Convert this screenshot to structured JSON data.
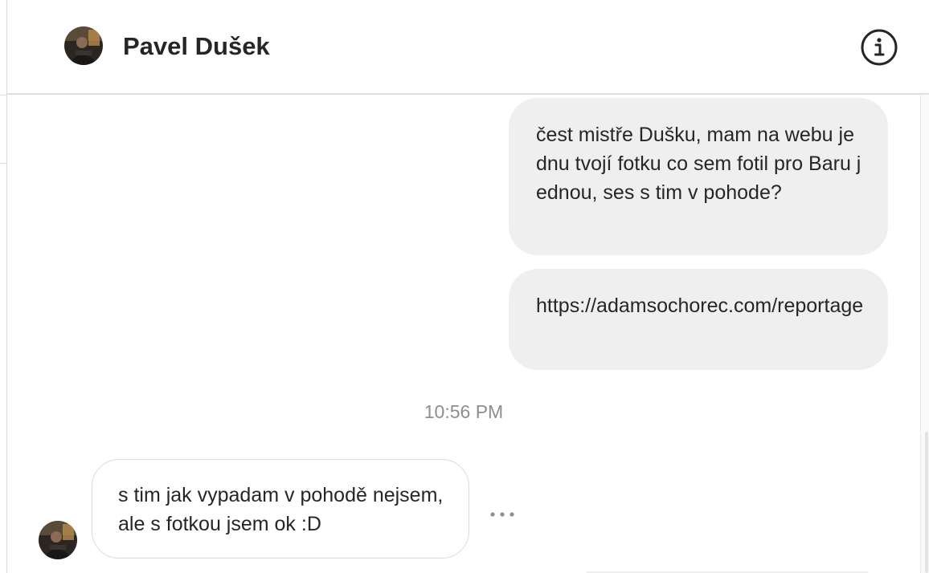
{
  "header": {
    "contact_name": "Pavel Dušek",
    "avatar_icon": "contact-avatar",
    "info_icon": "info-icon"
  },
  "messages": [
    {
      "direction": "outgoing",
      "text": "čest mistře Dušku, mam na webu jednu tvojí fotku co sem fotil pro Baru jednou, ses s tim v pohode?"
    },
    {
      "direction": "outgoing",
      "text": "https://adamsochorec.com/reportage"
    },
    {
      "direction": "incoming",
      "text": "s tim jak vypadam v pohodě nejsem, ale s fotkou jsem ok :D"
    }
  ],
  "timestamp": "10:56 PM",
  "more_icon": "more-options-icon",
  "colors": {
    "outgoing_bubble": "#efefef",
    "incoming_border": "#dbdbdb",
    "text": "#262626",
    "timestamp": "#8e8e8e"
  }
}
